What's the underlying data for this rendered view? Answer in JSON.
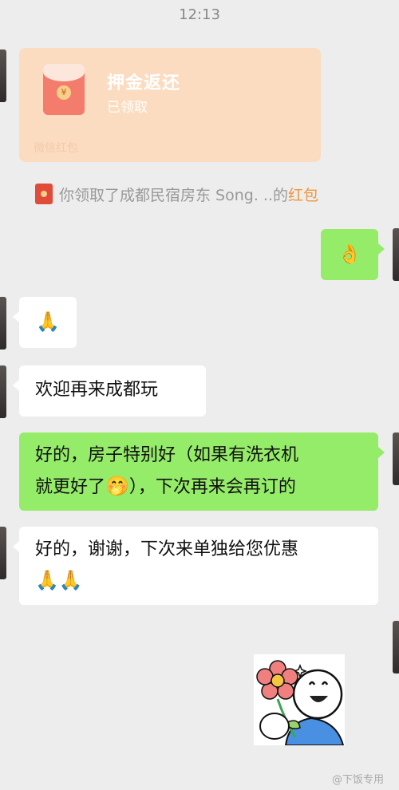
{
  "header": {
    "time": "12:13"
  },
  "red_packet": {
    "title": "押金返还",
    "status": "已领取",
    "footer": "微信红包",
    "coin_symbol": "¥",
    "colors": {
      "card": "#fbdcc0",
      "envelope": "#f37c6c"
    }
  },
  "system_notice": {
    "prefix": "你领取了成都民宿房东 Song. ..的",
    "highlight": "红包"
  },
  "messages": [
    {
      "id": "m1",
      "direction": "out",
      "type": "emoji",
      "text": "👌"
    },
    {
      "id": "m2",
      "direction": "in",
      "type": "emoji",
      "text": "🙏"
    },
    {
      "id": "m3",
      "direction": "in",
      "type": "text",
      "text": "欢迎再来成都玩"
    },
    {
      "id": "m4",
      "direction": "out",
      "type": "text",
      "line1": "好的，房子特别好（如果有洗衣机",
      "line2_a": "就更好了",
      "line2_emoji": "🤭",
      "line2_b": "），下次再来会再订的"
    },
    {
      "id": "m5",
      "direction": "in",
      "type": "text",
      "line1": "好的，谢谢，下次来单独给您优惠",
      "line2": "🙏🙏"
    },
    {
      "id": "m6",
      "direction": "out",
      "type": "sticker",
      "description_icon": "flower-smiley-sticker-icon"
    }
  ],
  "watermark": "@下饭专用",
  "colors": {
    "background": "#ededed",
    "outgoing": "#95ec69",
    "incoming": "#ffffff",
    "notice_highlight": "#f0963a"
  }
}
